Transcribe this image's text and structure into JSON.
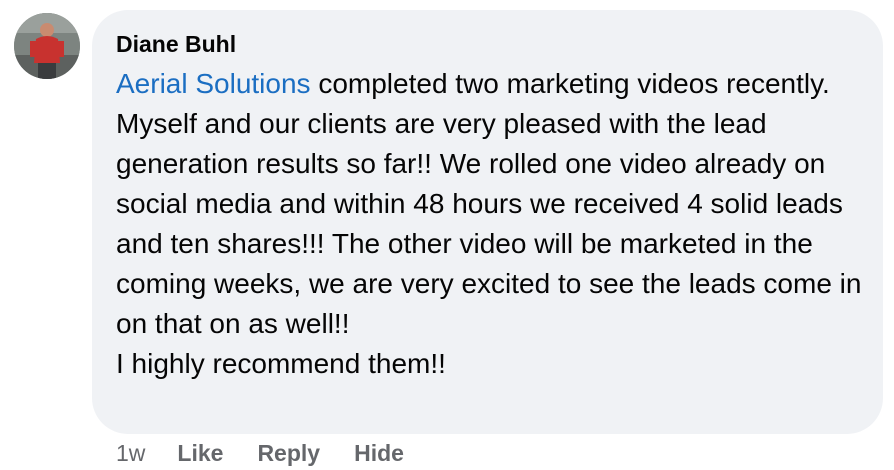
{
  "comment": {
    "author": "Diane Buhl",
    "mention": "Aerial Solutions",
    "body_lines": [
      " completed two marketing videos recently. Myself and our clients are very pleased with the lead generation results so far!! We rolled one video already on social media and within 48 hours we received 4 solid leads and ten shares!!! The other video will be marketed in the coming weeks, we are very excited to see the leads come in on that on as well!!"
    ],
    "last_line": "I highly recommend them!!",
    "timestamp": "1w",
    "actions": {
      "like": "Like",
      "reply": "Reply",
      "hide": "Hide"
    },
    "avatar_icon": "user-avatar-photo"
  },
  "colors": {
    "bubble": "#f0f2f5",
    "text": "#050505",
    "mention": "#1b6ec2",
    "meta": "#65676b"
  }
}
